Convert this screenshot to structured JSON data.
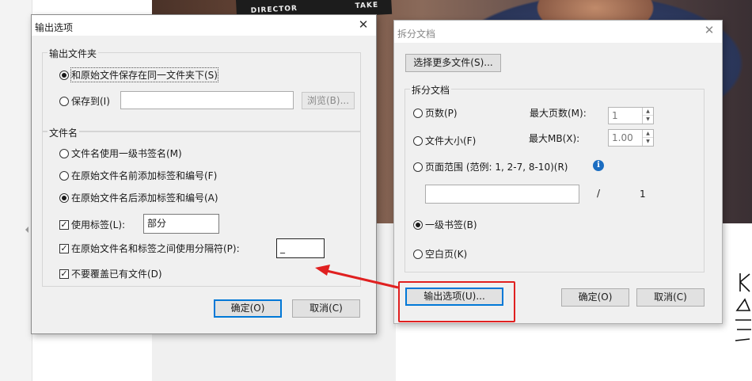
{
  "background": {
    "clapper_text_1": "DIRECTOR",
    "clapper_text_2": "TAKE"
  },
  "output_dialog": {
    "title": "输出选项",
    "folder_group": "输出文件夹",
    "same_folder": "和原始文件保存在同一文件夹下(S)",
    "save_to": "保存到(I)",
    "save_to_value": "",
    "browse": "浏览(B)...",
    "filename_group": "文件名",
    "use_bookmark_name": "文件名使用一级书签名(M)",
    "prefix_label": "在原始文件名前添加标签和编号(F)",
    "suffix_label": "在原始文件名后添加标签和编号(A)",
    "use_label": "使用标签(L):",
    "label_value": "部分",
    "use_separator": "在原始文件名和标签之间使用分隔符(P):",
    "separator_value": "_",
    "no_overwrite": "不要覆盖已有文件(D)",
    "ok": "确定(O)",
    "cancel": "取消(C)"
  },
  "split_dialog": {
    "title": "拆分文档",
    "select_more": "选择更多文件(S)...",
    "group": "拆分文档",
    "pages": "页数(P)",
    "max_pages_label": "最大页数(M):",
    "max_pages_value": "1",
    "file_size": "文件大小(F)",
    "max_mb_label": "最大MB(X):",
    "max_mb_value": "1.00",
    "page_range": "页面范围 (范例: 1, 2-7, 8-10)(R)",
    "range_value": "",
    "slash": "/",
    "total_pages": "1",
    "top_bookmark": "一级书签(B)",
    "blank_page": "空白页(K)",
    "output_options": "输出选项(U)...",
    "ok": "确定(O)",
    "cancel": "取消(C)"
  },
  "annotation": {
    "highlight_color": "#e02020"
  }
}
